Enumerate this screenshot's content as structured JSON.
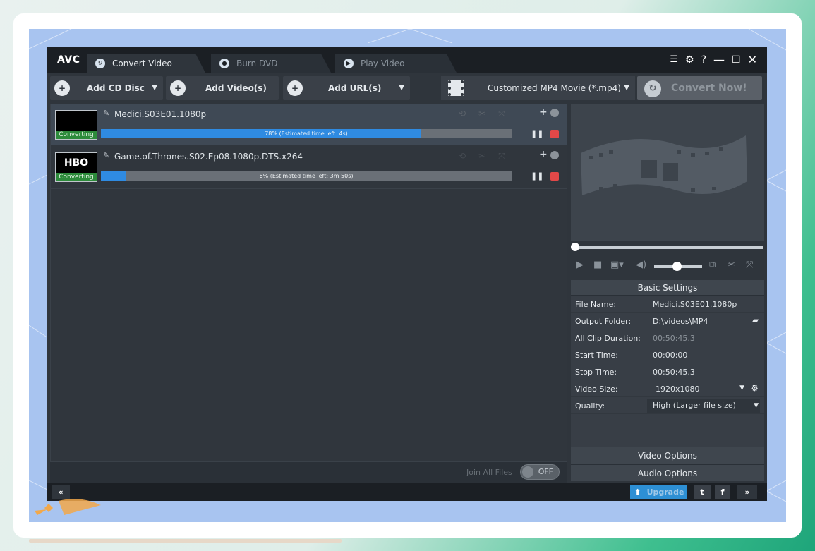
{
  "app": {
    "logo": "AVC",
    "tabs": [
      {
        "label": "Convert Video",
        "active": true
      },
      {
        "label": "Burn DVD",
        "active": false
      },
      {
        "label": "Play Video",
        "active": false
      }
    ],
    "window_controls": {
      "help": "?"
    }
  },
  "toolbar": {
    "add_cd": "Add CD Disc",
    "add_video": "Add Video(s)",
    "add_url": "Add URL(s)",
    "format": "Customized MP4 Movie (*.mp4)",
    "convert": "Convert Now!"
  },
  "files": [
    {
      "name": "Medici.S03E01.1080p",
      "thumb_text": "",
      "status": "Converting",
      "progress_percent": 78,
      "progress_text": "78% (Estimated time left: 4s)",
      "selected": true
    },
    {
      "name": "Game.of.Thrones.S02.Ep08.1080p.DTS.x264",
      "thumb_text": "HBO",
      "status": "Converting",
      "progress_percent": 6,
      "progress_text": "6% (Estimated time left: 3m 50s)",
      "selected": false
    }
  ],
  "join": {
    "label": "Join All Files",
    "toggle": "OFF"
  },
  "settings": {
    "title": "Basic Settings",
    "file_name": {
      "label": "File Name:",
      "value": "Medici.S03E01.1080p"
    },
    "output_folder": {
      "label": "Output Folder:",
      "value": "D:\\videos\\MP4"
    },
    "all_clip_duration": {
      "label": "All Clip Duration:",
      "value": "00:50:45.3"
    },
    "start_time": {
      "label": "Start Time:",
      "value": "00:00:00"
    },
    "stop_time": {
      "label": "Stop Time:",
      "value": "00:50:45.3"
    },
    "video_size": {
      "label": "Video Size:",
      "value": "1920x1080"
    },
    "quality": {
      "label": "Quality:",
      "value": "High (Larger file size)"
    }
  },
  "video_options": "Video Options",
  "audio_options": "Audio Options",
  "footer": {
    "collapse": "«",
    "expand": "»",
    "upgrade": "Upgrade"
  },
  "colors": {
    "accent": "#2f8be2",
    "stop": "#e24848",
    "status_green": "#2d8b3b"
  }
}
